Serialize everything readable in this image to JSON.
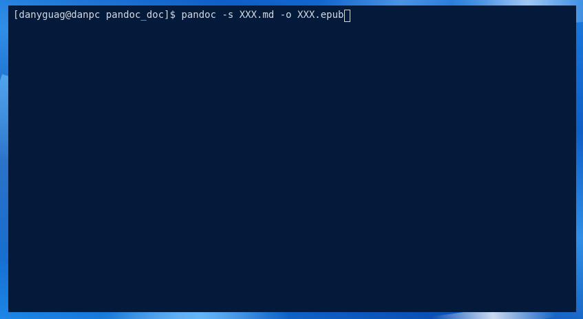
{
  "terminal": {
    "prompt": "[danyguag@danpc pandoc_doc]$ ",
    "command": "pandoc -s XXX.md -o XXX.epub"
  },
  "colors": {
    "terminal_background": "#031a3b",
    "terminal_text": "#d4d8df",
    "wallpaper_accent": "#1a7be0"
  }
}
